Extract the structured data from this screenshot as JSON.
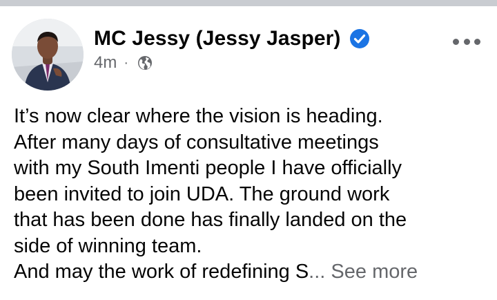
{
  "post": {
    "author": {
      "name": "MC Jessy (Jessy Jasper)",
      "verified": true,
      "verified_icon": "verified-badge-icon",
      "avatar_icon": "profile-photo"
    },
    "timestamp": "4m",
    "separator": "·",
    "privacy_icon": "globe-icon",
    "more_icon": "more-options-icon",
    "body_lines": [
      "It’s now clear where the vision is heading.",
      "After many days of consultative meetings",
      "with my South Imenti people I have officially",
      "been invited to join UDA. The ground work",
      "that has been done has finally landed on the",
      "side of winning team.",
      "And may the work of redefining S"
    ],
    "ellipsis": "...",
    "see_more_label": "See more"
  },
  "colors": {
    "text_primary": "#050505",
    "text_secondary": "#65676b",
    "verified_blue": "#1b74e4",
    "top_divider": "#c9ccd1"
  }
}
